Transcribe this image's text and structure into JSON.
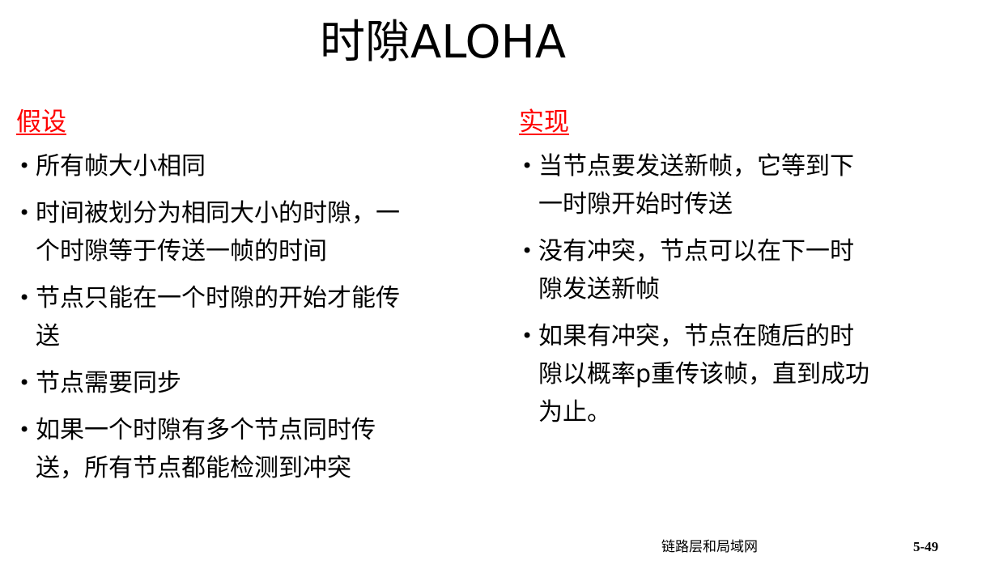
{
  "title": "时隙ALOHA",
  "left": {
    "heading": "假设",
    "items": [
      "所有帧大小相同",
      "时间被划分为相同大小的时隙，一个时隙等于传送一帧的时间",
      "节点只能在一个时隙的开始才能传送",
      "节点需要同步",
      "如果一个时隙有多个节点同时传送，所有节点都能检测到冲突"
    ]
  },
  "right": {
    "heading": "实现",
    "items": [
      "当节点要发送新帧，它等到下一时隙开始时传送",
      "没有冲突，节点可以在下一时隙发送新帧",
      "如果有冲突，节点在随后的时隙以概率p重传该帧，直到成功为止。"
    ]
  },
  "footer": {
    "label": "链路层和局域网",
    "page_number": "5-49"
  },
  "colors": {
    "heading": "#ff0000",
    "text": "#000000",
    "background": "#ffffff"
  }
}
